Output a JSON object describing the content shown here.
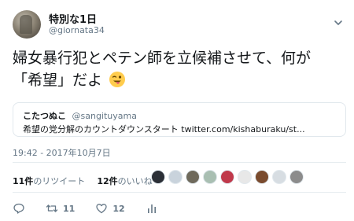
{
  "author": {
    "display_name": "特別な1日",
    "handle": "@giornata34"
  },
  "tweet": {
    "text_line1": "婦女暴行犯とペテン師を立候補させて、何が",
    "text_line2": "「希望」だよ",
    "emoji": "winking-face-with-tongue"
  },
  "quote": {
    "name": "こたつぬこ",
    "handle": "@sangituyama",
    "text": "希望の党分解のカウントダウンスタート twitter.com/kishaburaku/st..."
  },
  "timestamp": "19:42 - 2017年10月7日",
  "stats": {
    "retweets_count": "11件",
    "retweets_label": "のリツイート",
    "likes_count": "12件",
    "likes_label": "のいいね"
  },
  "likers": [
    "#2b2f36",
    "#c9d3dc",
    "#6f6a5c",
    "#a9bfb2",
    "#c0394b",
    "#e8e8e8",
    "#7a4b2e",
    "#d7dde2",
    "#8c8c8c"
  ],
  "actions": {
    "reply_count": "",
    "retweet_count": "11",
    "like_count": "12"
  },
  "colors": {
    "text": "#14171a",
    "secondary": "#657786",
    "border": "#e1e8ed"
  }
}
